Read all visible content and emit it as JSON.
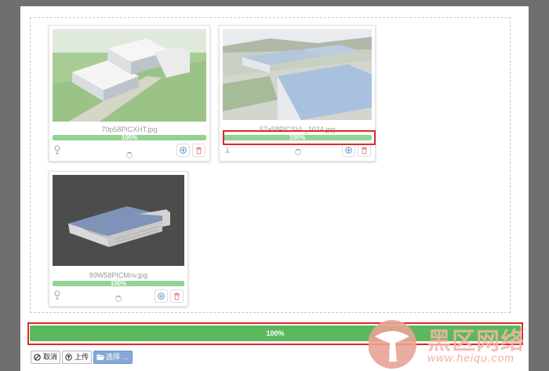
{
  "files": [
    {
      "name": "70p58PICXHT.jpg",
      "progress_label": "100%",
      "progress": 1.0
    },
    {
      "name": "57a58PICSVL_1024.jpg",
      "progress_label": "100%",
      "progress": 1.0
    },
    {
      "name": "89W58PICMnv.jpg",
      "progress_label": "100%",
      "progress": 1.0
    }
  ],
  "total": {
    "progress_label": "100%",
    "progress": 1.0
  },
  "buttons": {
    "cancel": "取消",
    "upload": "上传",
    "browse": "选择 …"
  },
  "watermark": {
    "text": "黑区网络",
    "url": "www.heiqu.com"
  },
  "colors": {
    "file_progress": "#92d293",
    "total_progress": "#5cb85c",
    "highlight": "#e1262a",
    "browse_button": "#84a9d6"
  },
  "icons": {
    "uploaded": "upload-status-icon",
    "zoom": "zoom-icon",
    "remove": "trash-icon",
    "cancel": "ban-icon",
    "upload": "upload-circle-icon",
    "browse": "folder-open-icon"
  }
}
